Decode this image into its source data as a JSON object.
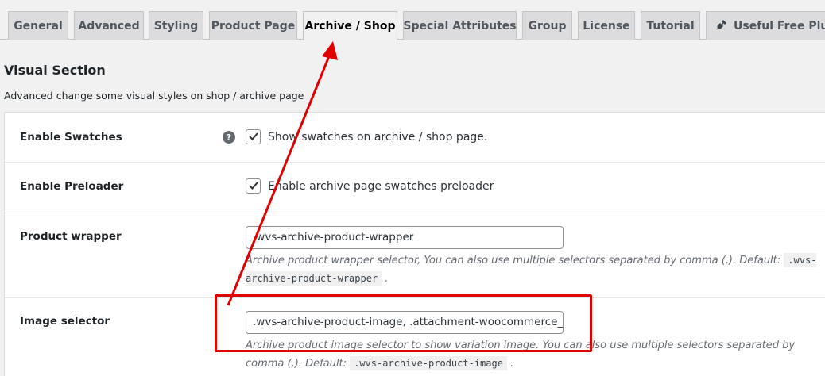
{
  "tabs": [
    {
      "label": "General"
    },
    {
      "label": "Advanced"
    },
    {
      "label": "Styling"
    },
    {
      "label": "Product Page"
    },
    {
      "label": "Archive / Shop",
      "active": true
    },
    {
      "label": "Special Attributes"
    },
    {
      "label": "Group"
    },
    {
      "label": "License"
    },
    {
      "label": "Tutorial"
    },
    {
      "label": "Useful Free Plugins",
      "icon": "plug-icon"
    }
  ],
  "section": {
    "title": "Visual Section",
    "description": "Advanced change some visual styles on shop / archive page"
  },
  "settings": {
    "enable_swatches": {
      "label": "Enable Swatches",
      "help_icon": "?",
      "checked": true,
      "checkbox_label": "Show swatches on archive / shop page."
    },
    "enable_preloader": {
      "label": "Enable Preloader",
      "checked": true,
      "checkbox_label": "Enable archive page swatches preloader"
    },
    "product_wrapper": {
      "label": "Product wrapper",
      "value": ".wvs-archive-product-wrapper",
      "description": "Archive product wrapper selector, You can also use multiple selectors separated by comma (,). Default:",
      "default_code": ".wvs-archive-product-wrapper"
    },
    "image_selector": {
      "label": "Image selector",
      "value": ".wvs-archive-product-image, .attachment-woocommerce_thumbnail",
      "description": "Archive product image selector to show variation image. You can also use multiple selectors separated by comma (,). Default:",
      "default_code": ".wvs-archive-product-image"
    }
  },
  "annotation": {
    "highlight_color": "#e00000",
    "arrow_color": "#e00000"
  }
}
